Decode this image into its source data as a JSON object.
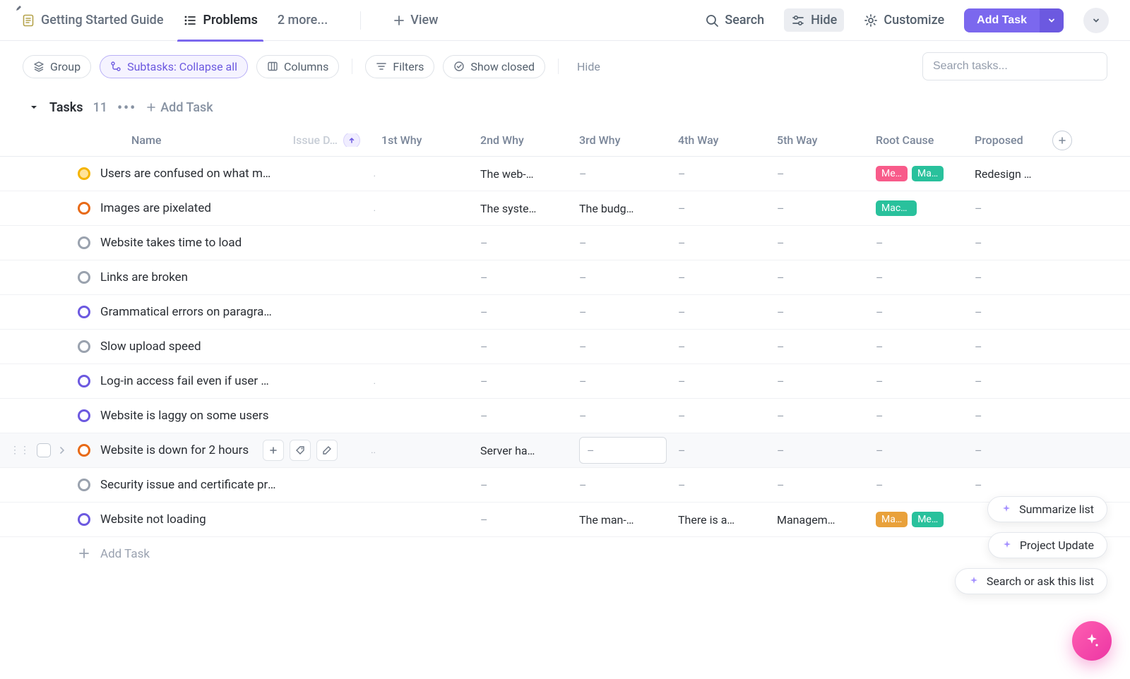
{
  "toolbar": {
    "tabs": [
      {
        "label": "Getting Started Guide",
        "icon": "doc",
        "active": false,
        "pinned": true
      },
      {
        "label": "Problems",
        "icon": "list",
        "active": true
      },
      {
        "label": "2 more...",
        "icon": "",
        "active": false
      }
    ],
    "add_view_label": "View",
    "search_label": "Search",
    "hide_label": "Hide",
    "customize_label": "Customize",
    "add_task_label": "Add Task"
  },
  "filters": {
    "group_label": "Group",
    "subtasks_label": "Subtasks: Collapse all",
    "columns_label": "Columns",
    "filters_label": "Filters",
    "show_closed_label": "Show closed",
    "hide_label": "Hide",
    "search_placeholder": "Search tasks..."
  },
  "group": {
    "title": "Tasks",
    "count": "11",
    "add_task_label": "Add Task"
  },
  "columns": {
    "name": "Name",
    "issue": "Issue D…",
    "why1": "1st Why",
    "why2": "2nd Why",
    "why3": "3rd Why",
    "way4": "4th Way",
    "way5": "5th Way",
    "root": "Root Cause",
    "proposed": "Proposed"
  },
  "status_colors": {
    "yellow": "#f5b400",
    "orange": "#e86a17",
    "gray": "#9aa2ae",
    "purple": "#6c59e0"
  },
  "tasks": [
    {
      "status": "yellow",
      "name": "Users are confused on what menu to click",
      "issue": ".",
      "why1": "",
      "why2": "The web-…",
      "why3": "–",
      "way4": "–",
      "way5": "–",
      "root": [
        {
          "label": "Me…",
          "color": "pink"
        },
        {
          "label": "Ma…",
          "color": "green"
        }
      ],
      "proposed": "Redesign …"
    },
    {
      "status": "orange",
      "name": "Images are pixelated",
      "issue": ".",
      "why1": "",
      "why2": "The syste…",
      "why3": "The budg…",
      "way4": "–",
      "way5": "–",
      "root": [
        {
          "label": "Machine",
          "color": "green"
        }
      ],
      "proposed": "–"
    },
    {
      "status": "gray",
      "name": "Website takes time to load",
      "issue": "",
      "why1": "",
      "why2": "–",
      "why3": "–",
      "way4": "–",
      "way5": "–",
      "root": [],
      "proposed": "–"
    },
    {
      "status": "gray",
      "name": "Links are broken",
      "issue": "",
      "why1": "",
      "why2": "–",
      "why3": "–",
      "way4": "–",
      "way5": "–",
      "root": [],
      "proposed": "–"
    },
    {
      "status": "purple",
      "name": "Grammatical errors on paragraphs",
      "issue": "",
      "why1": "",
      "why2": "–",
      "why3": "–",
      "way4": "–",
      "way5": "–",
      "root": [],
      "proposed": "–"
    },
    {
      "status": "gray",
      "name": "Slow upload speed",
      "issue": "",
      "why1": "",
      "why2": "–",
      "why3": "–",
      "way4": "–",
      "way5": "–",
      "root": [],
      "proposed": "–"
    },
    {
      "status": "purple",
      "name": "Log-in access fail even if user credentials…",
      "issue": ".",
      "why1": "",
      "why2": "–",
      "why3": "–",
      "way4": "–",
      "way5": "–",
      "root": [],
      "proposed": "–"
    },
    {
      "status": "purple",
      "name": "Website is laggy on some users",
      "issue": "",
      "why1": "",
      "why2": "–",
      "why3": "–",
      "way4": "–",
      "way5": "–",
      "root": [],
      "proposed": "–"
    },
    {
      "status": "orange",
      "name": "Website is down for 2 hours",
      "issue": "..",
      "why1": "",
      "why2": "Server ha…",
      "why3": "–",
      "why3_editing": true,
      "way4": "–",
      "way5": "–",
      "root": [],
      "proposed": "–",
      "hovered": true
    },
    {
      "status": "gray",
      "name": "Security issue and certificate problem",
      "issue": "",
      "why1": "",
      "why2": "–",
      "why3": "–",
      "way4": "–",
      "way5": "–",
      "root": [],
      "proposed": "–"
    },
    {
      "status": "purple",
      "name": "Website not loading",
      "issue": "",
      "why1": "",
      "why2": "–",
      "why3": "The man-…",
      "way4": "There is a…",
      "way5": "Managem…",
      "root": [
        {
          "label": "Ma…",
          "color": "orange"
        },
        {
          "label": "Me…",
          "color": "green"
        }
      ],
      "proposed": ""
    }
  ],
  "add_row_label": "Add Task",
  "ai_chips": {
    "summarize": "Summarize list",
    "project_update": "Project Update",
    "search_ask": "Search or ask this list"
  }
}
